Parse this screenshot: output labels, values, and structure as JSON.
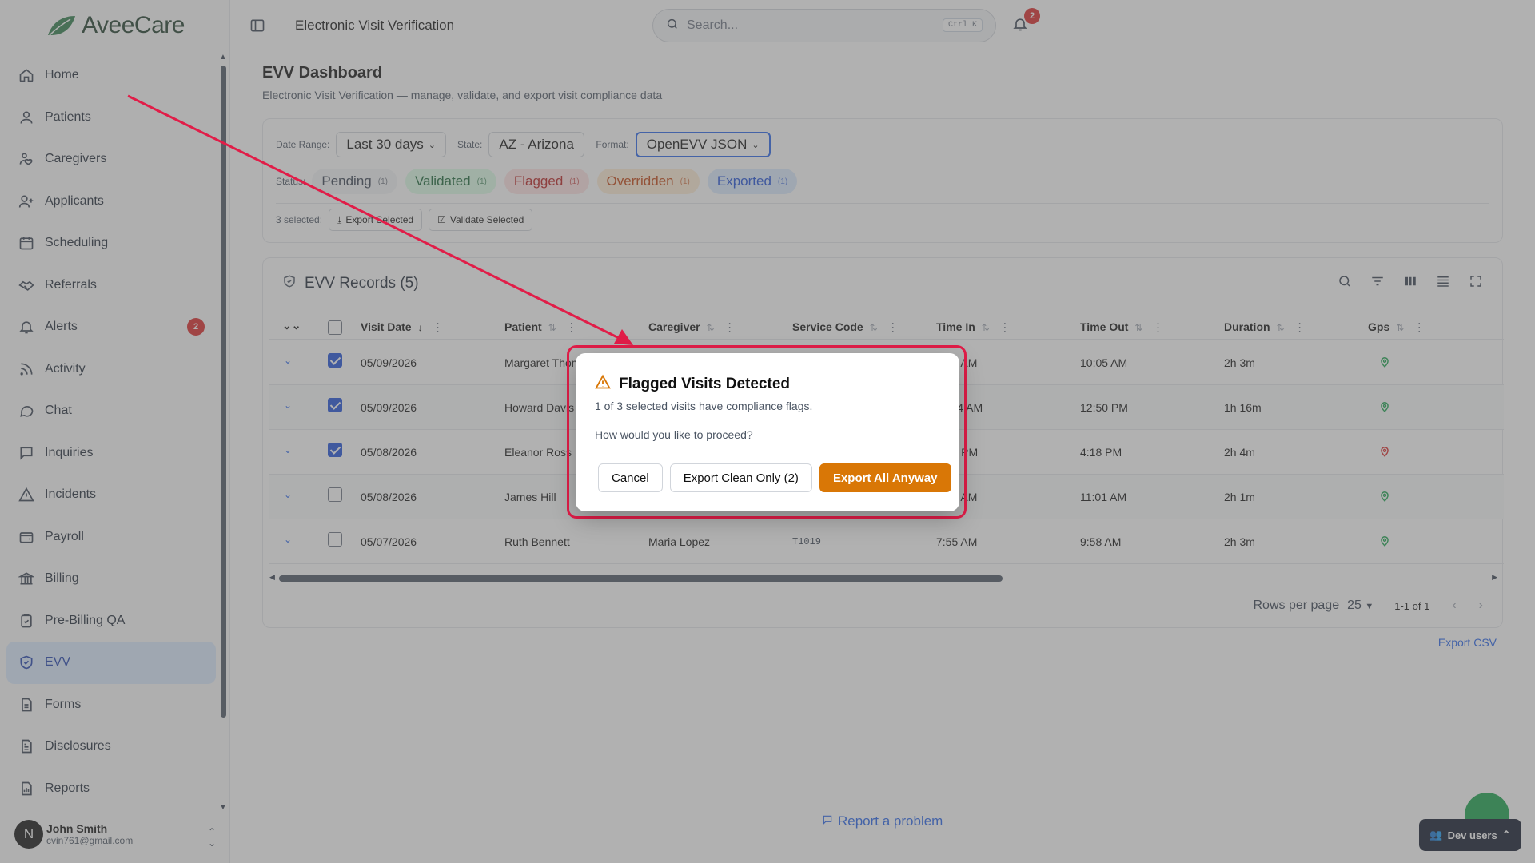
{
  "app": {
    "name": "AveeCare",
    "brand_color": "#2f7d4a"
  },
  "header": {
    "title": "Electronic Visit Verification",
    "search_placeholder": "Search...",
    "search_shortcut": "Ctrl K",
    "notification_count": "2"
  },
  "sidebar": {
    "items": [
      {
        "label": "Home",
        "icon": "home-icon"
      },
      {
        "label": "Patients",
        "icon": "user-icon"
      },
      {
        "label": "Caregivers",
        "icon": "caregiver-icon"
      },
      {
        "label": "Applicants",
        "icon": "user-plus-icon"
      },
      {
        "label": "Scheduling",
        "icon": "calendar-icon"
      },
      {
        "label": "Referrals",
        "icon": "handshake-icon"
      },
      {
        "label": "Alerts",
        "icon": "bell-icon",
        "badge": "2"
      },
      {
        "label": "Activity",
        "icon": "rss-icon"
      },
      {
        "label": "Chat",
        "icon": "chat-icon"
      },
      {
        "label": "Inquiries",
        "icon": "message-square-icon"
      },
      {
        "label": "Incidents",
        "icon": "warning-icon"
      },
      {
        "label": "Payroll",
        "icon": "wallet-icon"
      },
      {
        "label": "Billing",
        "icon": "bank-icon"
      },
      {
        "label": "Pre-Billing QA",
        "icon": "clipboard-check-icon"
      },
      {
        "label": "EVV",
        "icon": "shield-check-icon",
        "active": true
      },
      {
        "label": "Forms",
        "icon": "file-icon"
      },
      {
        "label": "Disclosures",
        "icon": "file-text-icon"
      },
      {
        "label": "Reports",
        "icon": "chart-icon"
      }
    ],
    "user": {
      "initial": "N",
      "name": "John Smith",
      "email": "cvin761@gmail.com"
    }
  },
  "dashboard": {
    "title": "EVV Dashboard",
    "subtitle": "Electronic Visit Verification — manage, validate, and export visit compliance data",
    "filters": {
      "date_range_label": "Date Range:",
      "date_range_value": "Last 30 days",
      "state_label": "State:",
      "state_value": "AZ - Arizona",
      "format_label": "Format:",
      "format_value": "OpenEVV JSON",
      "status_label": "Status:"
    },
    "status_chips": [
      {
        "label": "Pending",
        "count": "(1)"
      },
      {
        "label": "Validated",
        "count": "(1)"
      },
      {
        "label": "Flagged",
        "count": "(1)"
      },
      {
        "label": "Overridden",
        "count": "(1)"
      },
      {
        "label": "Exported",
        "count": "(1)"
      }
    ],
    "selection": {
      "text": "3 selected:",
      "export_selected": "Export Selected",
      "validate_selected": "Validate Selected"
    }
  },
  "table": {
    "title": "EVV Records (5)",
    "columns": [
      "Visit Date",
      "Patient",
      "Caregiver",
      "Service Code",
      "Time In",
      "Time Out",
      "Duration",
      "Gps"
    ],
    "rows": [
      {
        "checked": true,
        "visit_date": "05/09/2026",
        "patient": "Margaret Thompson",
        "caregiver": "",
        "service_code": "",
        "time_in": "8:02 AM",
        "time_out": "10:05 AM",
        "duration": "2h 3m",
        "gps_status": "ok"
      },
      {
        "checked": true,
        "visit_date": "05/09/2026",
        "patient": "Howard Davis",
        "caregiver": "",
        "service_code": "",
        "time_in": "11:34 AM",
        "time_out": "12:50 PM",
        "duration": "1h 16m",
        "gps_status": "ok"
      },
      {
        "checked": true,
        "visit_date": "05/08/2026",
        "patient": "Eleanor Ross",
        "caregiver": "",
        "service_code": "",
        "time_in": "2:14 PM",
        "time_out": "4:18 PM",
        "duration": "2h 4m",
        "gps_status": "flag"
      },
      {
        "checked": false,
        "visit_date": "05/08/2026",
        "patient": "James Hill",
        "caregiver": "",
        "service_code": "",
        "time_in": "9:00 AM",
        "time_out": "11:01 AM",
        "duration": "2h 1m",
        "gps_status": "ok"
      },
      {
        "checked": false,
        "visit_date": "05/07/2026",
        "patient": "Ruth Bennett",
        "caregiver": "Maria Lopez",
        "service_code": "T1019",
        "time_in": "7:55 AM",
        "time_out": "9:58 AM",
        "duration": "2h 3m",
        "gps_status": "ok"
      }
    ],
    "pager": {
      "rows_per_page_label": "Rows per page",
      "rows_per_page": "25",
      "range": "1-1 of 1"
    },
    "export_csv": "Export CSV"
  },
  "footer": {
    "report_problem": "Report a problem",
    "dev_users": "Dev users"
  },
  "modal": {
    "title": "Flagged Visits Detected",
    "message": "1 of 3 selected visits have compliance flags.",
    "question": "How would you like to proceed?",
    "cancel": "Cancel",
    "export_clean": "Export Clean Only (2)",
    "export_all": "Export All Anyway",
    "accent_color": "#d97706"
  },
  "annotation_color": "#e11d48"
}
